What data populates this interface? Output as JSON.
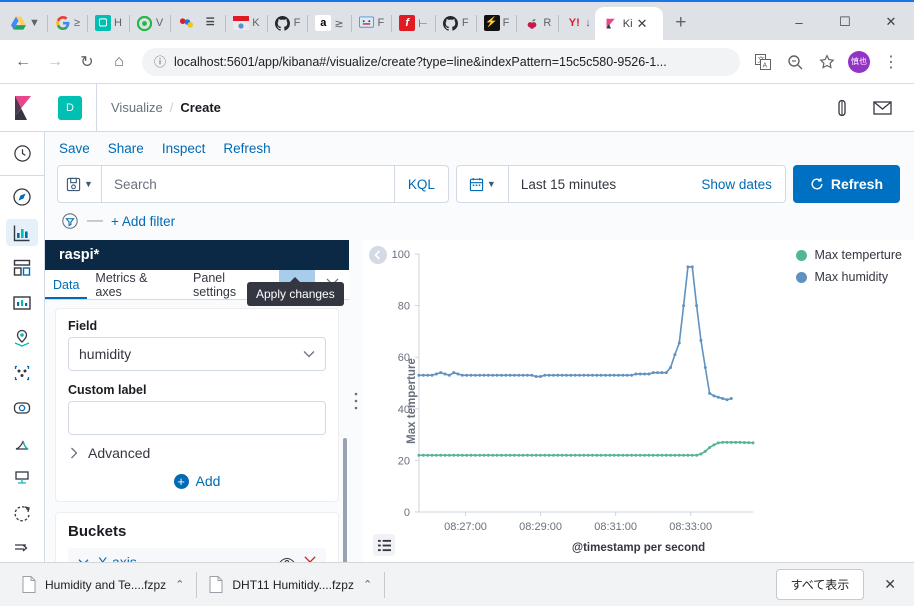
{
  "browser": {
    "bookmarks": [
      {
        "label": "",
        "icon": "google-drive-icon",
        "color": "#ffffff"
      },
      {
        "label": "",
        "icon": "filter-icon",
        "color": "#ffffff"
      },
      {
        "label": "",
        "icon": "google-icon",
        "color": "#ffffff"
      },
      {
        "label": "",
        "icon": "script-icon",
        "color": "#ffffff"
      },
      {
        "label": "H",
        "icon": "evernote-icon",
        "color": "#00bfb3"
      },
      {
        "label": "V",
        "icon": "green-circle-icon",
        "color": "#21ba45"
      },
      {
        "label": "",
        "icon": "colorful-icon",
        "color": "#ffffff"
      },
      {
        "label": "",
        "icon": "book-icon",
        "color": "#ffffff"
      },
      {
        "label": "K",
        "icon": "arduino-icon",
        "color": "#ffffff"
      },
      {
        "label": "F",
        "icon": "github-icon",
        "color": "#24292e"
      },
      {
        "label": "",
        "icon": "amazon-icon",
        "color": "#ff9900"
      },
      {
        "label": "F",
        "icon": "monitor-icon",
        "color": "#4f94d4"
      },
      {
        "label": "H",
        "icon": "flickr-icon",
        "color": "#e01b24"
      },
      {
        "label": "F",
        "icon": "github-icon",
        "color": "#24292e"
      },
      {
        "label": "F",
        "icon": "bolt-icon",
        "color": "#111111"
      },
      {
        "label": "R",
        "icon": "raspberry-icon",
        "color": "#c51a4a"
      },
      {
        "label": "",
        "icon": "yahoo-icon",
        "color": "#e01b24"
      }
    ],
    "tab": {
      "title": "Ki",
      "favicon": "kibana-icon"
    },
    "new_tab_label": "+",
    "window_controls": {
      "minimize": "–",
      "maximize": "☐",
      "close": "✕"
    },
    "url": "localhost:5601/app/kibana#/visualize/create?type=line&indexPattern=15c5c580-9526-1...",
    "nav": {
      "back": "←",
      "forward": "→",
      "reload": "↻",
      "home": "⌂"
    },
    "avatar_label": "慎也"
  },
  "kibana": {
    "space_badge": "D",
    "breadcrumb": {
      "parent": "Visualize",
      "separator": "/",
      "current": "Create"
    },
    "nav_items": [
      {
        "name": "recently-viewed",
        "icon": "clock-icon",
        "selected": false
      },
      {
        "name": "discover",
        "icon": "compass-icon",
        "selected": false
      },
      {
        "name": "visualize",
        "icon": "bar-chart-icon",
        "selected": true
      },
      {
        "name": "dashboard",
        "icon": "dashboard-icon",
        "selected": false
      },
      {
        "name": "canvas",
        "icon": "presentation-icon",
        "selected": false
      },
      {
        "name": "maps",
        "icon": "map-marker-icon",
        "selected": false
      },
      {
        "name": "machine-learning",
        "icon": "ml-nodes-icon",
        "selected": false
      },
      {
        "name": "infrastructure",
        "icon": "infra-icon",
        "selected": false
      },
      {
        "name": "logs",
        "icon": "logs-icon",
        "selected": false
      },
      {
        "name": "apm",
        "icon": "apm-icon",
        "selected": false
      },
      {
        "name": "uptime",
        "icon": "uptime-icon",
        "selected": false
      },
      {
        "name": "collapse-nav",
        "icon": "arrow-right-icon",
        "selected": false
      }
    ],
    "top_actions": [
      "Save",
      "Share",
      "Inspect",
      "Refresh"
    ],
    "query_bar": {
      "saved_query_icon": "save-icon",
      "search_placeholder": "Search",
      "language": "KQL",
      "calendar_icon": "calendar-icon",
      "time_range": "Last 15 minutes",
      "show_dates": "Show dates",
      "refresh_label": "Refresh"
    },
    "filter_bar": {
      "icon": "filter-icon",
      "dash": "—",
      "add_filter": "+ Add filter"
    },
    "config_panel": {
      "title": "raspi*",
      "tabs": [
        {
          "label": "Data",
          "active": true
        },
        {
          "label": "Metrics & axes",
          "active": false
        },
        {
          "label": "Panel settings",
          "active": false
        }
      ],
      "apply_icon": "play-icon",
      "apply_tooltip": "Apply changes",
      "close_icon": "close-icon",
      "field_label": "Field",
      "field_value": "humidity",
      "custom_label_label": "Custom label",
      "custom_label_value": "",
      "advanced_label": "Advanced",
      "add_label": "Add",
      "buckets_header": "Buckets",
      "bucket_rows": [
        {
          "label": "X-axis",
          "eye_icon": "eye-icon",
          "remove_icon": "remove-icon"
        }
      ]
    }
  },
  "chart_data": {
    "type": "line",
    "title": "",
    "xlabel": "@timestamp per second",
    "ylabel": "Max temperture",
    "ylim": [
      0,
      100
    ],
    "yticks": [
      0,
      20,
      40,
      60,
      80,
      100
    ],
    "xticks": [
      "08:27:00",
      "08:29:00",
      "08:31:00",
      "08:33:00"
    ],
    "grid": false,
    "legend_position": "top-right",
    "colors": {
      "max_temperture": "#54b399",
      "max_humidity": "#6092c0"
    },
    "series": [
      {
        "name": "Max temperture",
        "color": "#54b399",
        "values": [
          22,
          22,
          22,
          22,
          22,
          22,
          22,
          22,
          22,
          22,
          22,
          22,
          22,
          22,
          22,
          22,
          22,
          22,
          22,
          22,
          22,
          22,
          22,
          22,
          22,
          22,
          22,
          22,
          22,
          22,
          22,
          22,
          22,
          22,
          22,
          22,
          22,
          22,
          22,
          22,
          22,
          22,
          22,
          22,
          22,
          22,
          22,
          22,
          22,
          22,
          22,
          22,
          22,
          22,
          22,
          22,
          22,
          22,
          22,
          22,
          22,
          22,
          22,
          22,
          22,
          22.5,
          23.5,
          25,
          26,
          26.8,
          27,
          27,
          27,
          27,
          27,
          26.9,
          26.9,
          26.8
        ]
      },
      {
        "name": "Max humidity",
        "color": "#6092c0",
        "values": [
          53,
          53,
          53,
          53,
          53.5,
          54,
          53.5,
          53,
          54,
          53.5,
          53,
          53,
          53,
          53,
          53,
          53,
          53,
          53,
          53,
          53,
          53,
          53,
          53,
          53,
          53,
          53,
          53,
          52.5,
          52.5,
          53,
          53,
          53,
          53,
          53,
          53,
          53,
          53,
          53,
          53,
          53,
          53,
          53,
          53,
          53,
          53,
          53,
          53,
          53,
          53,
          53,
          53.5,
          53.5,
          53.5,
          53.5,
          54,
          54,
          54,
          54,
          56,
          61,
          65.5,
          80,
          95,
          95,
          80,
          66.5,
          56,
          46,
          45,
          44.5,
          44,
          43.5,
          44
        ]
      }
    ],
    "legend": [
      {
        "label": "Max temperture",
        "color": "#54b399"
      },
      {
        "label": "Max humidity",
        "color": "#6092c0"
      }
    ],
    "collapse_icon": "chevron-left-icon",
    "legend_toggle_icon": "list-icon"
  },
  "downloads": {
    "items": [
      {
        "name": "Humidity and Te....fzpz",
        "icon": "file-icon",
        "caret": "⌃"
      },
      {
        "name": "DHT11 Humitidy....fzpz",
        "icon": "file-icon",
        "caret": "⌃"
      }
    ],
    "show_all_label": "すべて表示",
    "close_label": "✕"
  }
}
